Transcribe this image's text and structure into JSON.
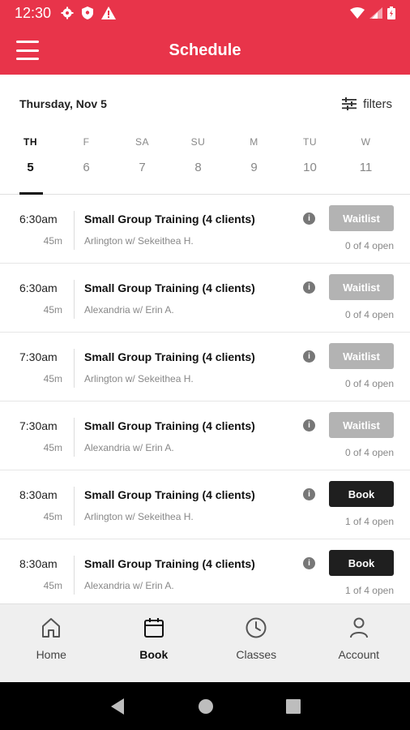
{
  "status_bar": {
    "time": "12:30"
  },
  "app_bar": {
    "title": "Schedule"
  },
  "date_header": {
    "date": "Thursday, Nov 5",
    "filters_label": "filters"
  },
  "days": [
    {
      "abbr": "TH",
      "num": "5",
      "active": true
    },
    {
      "abbr": "F",
      "num": "6"
    },
    {
      "abbr": "SA",
      "num": "7"
    },
    {
      "abbr": "SU",
      "num": "8"
    },
    {
      "abbr": "M",
      "num": "9"
    },
    {
      "abbr": "TU",
      "num": "10"
    },
    {
      "abbr": "W",
      "num": "11"
    }
  ],
  "classes": [
    {
      "time": "6:30am",
      "duration": "45m",
      "name": "Small Group Training (4 clients)",
      "location": "Arlington w/ Sekeithea H.",
      "action": "Waitlist",
      "availability": "0 of 4 open"
    },
    {
      "time": "6:30am",
      "duration": "45m",
      "name": "Small Group Training (4 clients)",
      "location": "Alexandria w/ Erin A.",
      "action": "Waitlist",
      "availability": "0 of 4 open"
    },
    {
      "time": "7:30am",
      "duration": "45m",
      "name": "Small Group Training (4 clients)",
      "location": "Arlington w/ Sekeithea H.",
      "action": "Waitlist",
      "availability": "0 of 4 open"
    },
    {
      "time": "7:30am",
      "duration": "45m",
      "name": "Small Group Training (4 clients)",
      "location": "Alexandria w/ Erin A.",
      "action": "Waitlist",
      "availability": "0 of 4 open"
    },
    {
      "time": "8:30am",
      "duration": "45m",
      "name": "Small Group Training (4 clients)",
      "location": "Arlington w/ Sekeithea H.",
      "action": "Book",
      "availability": "1 of 4 open"
    },
    {
      "time": "8:30am",
      "duration": "45m",
      "name": "Small Group Training (4 clients)",
      "location": "Alexandria w/ Erin A.",
      "action": "Book",
      "availability": "1 of 4 open"
    }
  ],
  "bottom_nav": [
    {
      "label": "Home",
      "icon": "home-icon"
    },
    {
      "label": "Book",
      "icon": "calendar-icon",
      "active": true
    },
    {
      "label": "Classes",
      "icon": "clock-icon"
    },
    {
      "label": "Account",
      "icon": "person-icon"
    }
  ],
  "colors": {
    "brand": "#e8344a",
    "waitlist": "#b3b3b3",
    "book": "#1f1f1f"
  }
}
